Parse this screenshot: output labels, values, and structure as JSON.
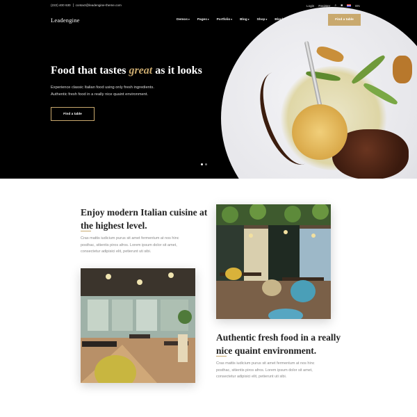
{
  "topbar": {
    "phone": "(222) 400 630",
    "email": "contact@leadengine-theme.com",
    "login": "Login",
    "register": "Register",
    "language": "EN"
  },
  "header": {
    "brand": "Leadengine",
    "nav": [
      "Demos",
      "Pages",
      "Portfolio",
      "Blog",
      "Shop",
      "Blocks",
      "Elements"
    ],
    "cta": "Find a table"
  },
  "hero": {
    "title_pre": "Food that tastes ",
    "title_accent": "great",
    "title_post": " as it looks",
    "sub_line1": "Experience classic Italian food using only fresh ingredients.",
    "sub_line2": "Authentic fresh food in a really nice quaint environment.",
    "button": "Find a table",
    "slides": 2,
    "active_slide": 1
  },
  "section1": {
    "title_line1": "Enjoy modern Italian cuisine at",
    "title_line2": "the highest level.",
    "text_line1": "Cras mattis iudicium purus sit amet fermentum at nos hinc",
    "text_line2": "posthac, sitientis piros afros. Lorem ipsum dolor sit amet,",
    "text_line3": "consectetur adipisici elit, petierunt uti sibi."
  },
  "section2": {
    "title_line1": "Authentic fresh food in a really",
    "title_line2": "nice quaint environment.",
    "text_line1": "Cras mattis iudicium purus sit amet fermentum at nos hinc",
    "text_line2": "posthac, sitientis piros afros. Lorem ipsum dolor sit amet,",
    "text_line3": "consectetur adipisici elit, petierunt uti sibi."
  },
  "colors": {
    "accent": "#c9a96e",
    "hero_bg": "#000000"
  }
}
